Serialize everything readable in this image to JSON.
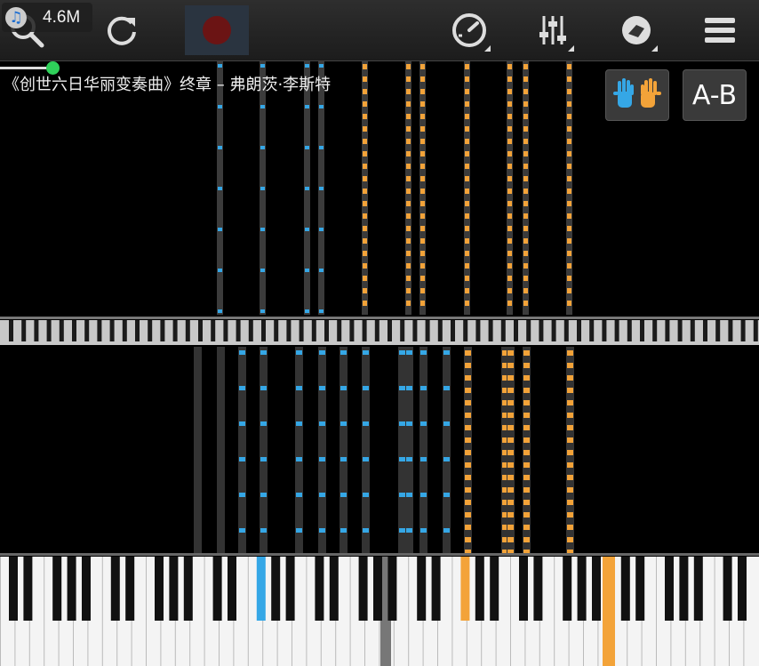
{
  "toolbar": {
    "memory_value": "4.6M",
    "memory_icon": "music-note-icon",
    "buttons": [
      {
        "name": "search-icon"
      },
      {
        "name": "replay-icon"
      },
      {
        "name": "record-icon"
      },
      {
        "name": "speed-gauge-icon"
      },
      {
        "name": "mixer-sliders-icon"
      },
      {
        "name": "piano-settings-icon"
      },
      {
        "name": "menu-icon"
      }
    ]
  },
  "playback": {
    "progress_percent": 7
  },
  "song": {
    "title": "《创世六日华丽变奏曲》终章 – 弗朗茨·李斯特"
  },
  "controls": {
    "hands_icon": "both-hands-icon",
    "ab_label": "A-B"
  },
  "colors": {
    "left_hand": "#35a7e6",
    "right_hand": "#f3a339",
    "background": "#000000",
    "lane": "#3b3b3b"
  }
}
